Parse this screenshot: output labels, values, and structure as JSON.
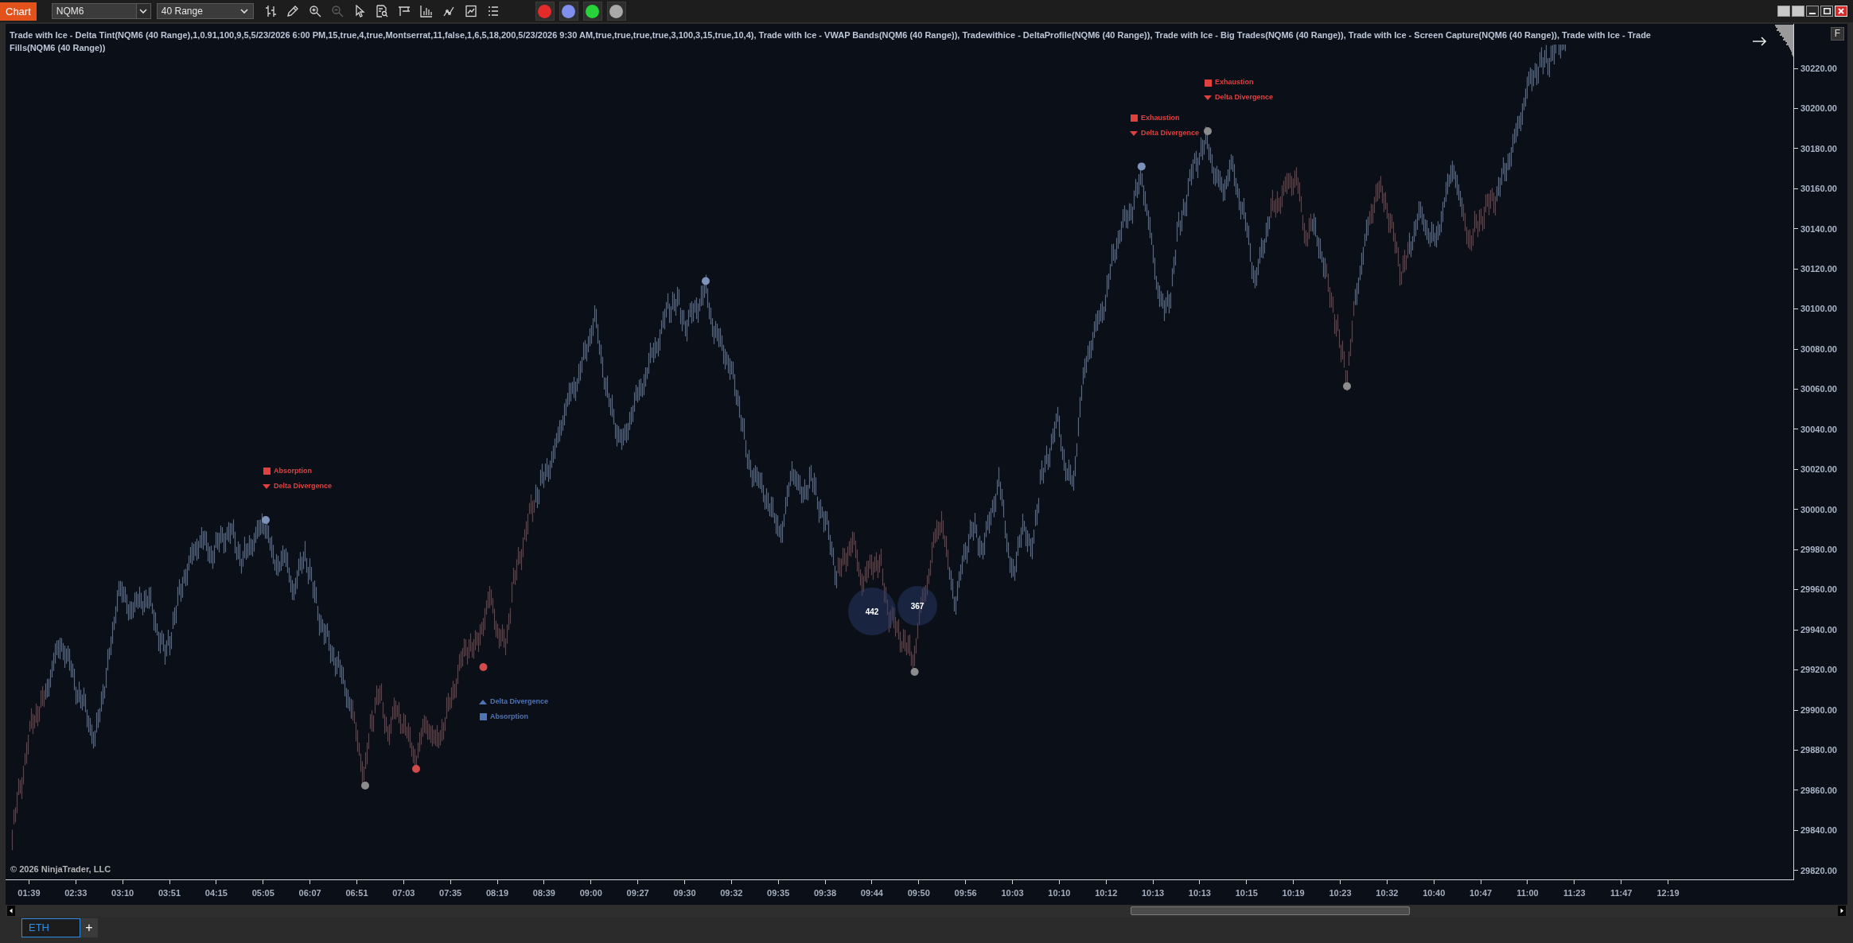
{
  "toolbar": {
    "chart_button": "Chart",
    "instrument": "NQM6",
    "interval": "40 Range",
    "tools": [
      {
        "disabled": false
      },
      {
        "disabled": false
      },
      {
        "disabled": false
      },
      {
        "disabled": true
      },
      {
        "disabled": false
      },
      {
        "disabled": false
      },
      {
        "disabled": false
      },
      {
        "disabled": false
      },
      {
        "disabled": false
      },
      {
        "disabled": false
      },
      {
        "disabled": false
      }
    ],
    "color_buttons": [
      {
        "color": "#e42b2b"
      },
      {
        "color": "#7f90ee"
      },
      {
        "color": "#28d33a"
      },
      {
        "color": "#a9a9a9"
      }
    ]
  },
  "chart": {
    "indicators": "Trade with Ice - Delta Tint(NQM6 (40 Range),1,0.91,100,9,5,5/23/2026 6:00 PM,15,true,4,true,Montserrat,11,false,1,6,5,18,200,5/23/2026 9:30 AM,true,true,true,true,3,100,3,15,true,10,4), Trade with Ice - VWAP Bands(NQM6 (40 Range)), Tradewithice - DeltaProfile(NQM6 (40 Range)), Trade with Ice - Big Trades(NQM6 (40 Range)), Trade with Ice - Screen Capture(NQM6 (40 Range)), Trade with Ice - Trade Fills(NQM6 (40 Range))",
    "axis_button": "F",
    "signals": [
      {
        "items": [
          {
            "label": "Absorption",
            "kind": "square",
            "color": "#e0413f"
          },
          {
            "label": "Delta Divergence",
            "kind": "down",
            "color": "#e0413f"
          }
        ]
      },
      {
        "items": [
          {
            "label": "Delta Divergence",
            "kind": "up",
            "color": "#4f74b5"
          },
          {
            "label": "Absorption",
            "kind": "square",
            "color": "#4f74b5"
          }
        ]
      },
      {
        "items": [
          {
            "label": "Exhaustion",
            "kind": "square",
            "color": "#e0413f"
          },
          {
            "label": "Delta Divergence",
            "kind": "down",
            "color": "#e0413f"
          }
        ]
      },
      {
        "items": [
          {
            "label": "Exhaustion",
            "kind": "square",
            "color": "#e0413f"
          },
          {
            "label": "Delta Divergence",
            "kind": "down",
            "color": "#e0413f"
          }
        ]
      }
    ],
    "pivots": [
      {
        "color": "#7d92b8"
      },
      {
        "color": "#8c8c8c"
      },
      {
        "color": "#d24a4a"
      },
      {
        "color": "#d24a4a"
      },
      {
        "color": "#7d92b8"
      },
      {
        "color": "#8c8c8c"
      },
      {
        "color": "#7d92b8"
      },
      {
        "color": "#8c8c8c"
      },
      {
        "color": "#8c8c8c"
      }
    ],
    "big_trades": [
      {
        "value": "442"
      },
      {
        "value": "367"
      }
    ],
    "copyright": "© 2026 NinjaTrader, LLC",
    "price_axis": {
      "labels": [
        "30220.00",
        "30200.00",
        "30180.00",
        "30160.00",
        "30140.00",
        "30120.00",
        "30100.00",
        "30080.00",
        "30060.00",
        "30040.00",
        "30020.00",
        "30000.00",
        "29980.00",
        "29960.00",
        "29940.00",
        "29920.00",
        "29900.00",
        "29880.00",
        "29860.00",
        "29840.00",
        "29820.00"
      ]
    },
    "time_axis": {
      "labels": [
        "01:39",
        "02:33",
        "03:10",
        "03:51",
        "04:15",
        "05:05",
        "06:07",
        "06:51",
        "07:03",
        "07:35",
        "08:19",
        "08:39",
        "09:00",
        "09:27",
        "09:30",
        "09:32",
        "09:35",
        "09:38",
        "09:44",
        "09:50",
        "09:56",
        "10:03",
        "10:10",
        "10:12",
        "10:13",
        "10:13",
        "10:15",
        "10:19",
        "10:23",
        "10:32",
        "10:40",
        "10:47",
        "11:00",
        "11:23",
        "11:47",
        "12:19"
      ]
    }
  },
  "tabs": [
    {
      "label": "ETH",
      "selected": true
    }
  ],
  "add_tab": "+"
}
